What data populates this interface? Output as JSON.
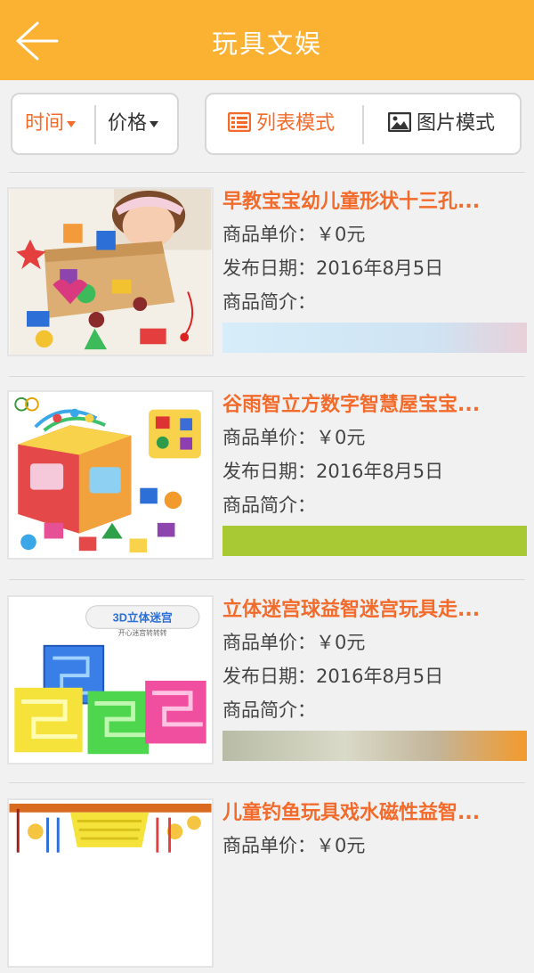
{
  "header": {
    "title": "玩具文娱",
    "back_icon": "back-arrow-icon"
  },
  "sort": {
    "time_label": "时间",
    "price_label": "价格"
  },
  "mode": {
    "list_label": "列表模式",
    "picture_label": "图片模式"
  },
  "colors": {
    "brand": "#fbb131",
    "accent": "#f36b2b"
  },
  "products": [
    {
      "name": "早教宝宝幼儿童形状十三孔...",
      "price": "商品单价：￥0元",
      "date": "发布日期：2016年8月5日",
      "intro": "商品简介：",
      "banner_color": "#cfe6f5"
    },
    {
      "name": "谷雨智立方数字智慧屋宝宝...",
      "price": "商品单价：￥0元",
      "date": "发布日期：2016年8月5日",
      "intro": "商品简介：",
      "banner_color": "#a9c934"
    },
    {
      "name": "立体迷宫球益智迷宫玩具走...",
      "price": "商品单价：￥0元",
      "date": "发布日期：2016年8月5日",
      "intro": "商品简介：",
      "banner_color": "#c8cbb8"
    },
    {
      "name": "儿童钓鱼玩具戏水磁性益智...",
      "price": "商品单价：￥0元",
      "date": "",
      "intro": "",
      "banner_color": ""
    }
  ],
  "thumb_labels": {
    "maze_badge": "3D立体迷宫",
    "maze_sub": "开心迷宫转转转"
  }
}
